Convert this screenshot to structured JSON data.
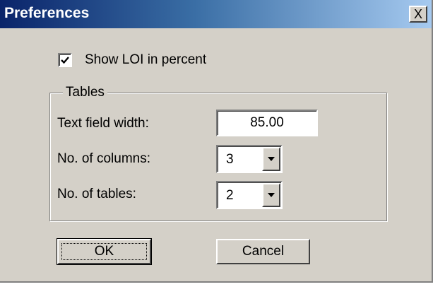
{
  "window": {
    "title": "Preferences",
    "close_glyph": "X"
  },
  "options": {
    "show_loi_label": "Show LOI in percent",
    "show_loi_checked": true
  },
  "tables": {
    "group_label": "Tables",
    "text_field_width_label": "Text field width:",
    "text_field_width_value": "85.00",
    "columns_label": "No. of columns:",
    "columns_value": "3",
    "tables_label": "No. of tables:",
    "tables_value": "2"
  },
  "buttons": {
    "ok_label": "OK",
    "cancel_label": "Cancel"
  },
  "icons": {
    "check": "check-icon",
    "close": "close-icon",
    "dropdown": "chevron-down-icon"
  }
}
